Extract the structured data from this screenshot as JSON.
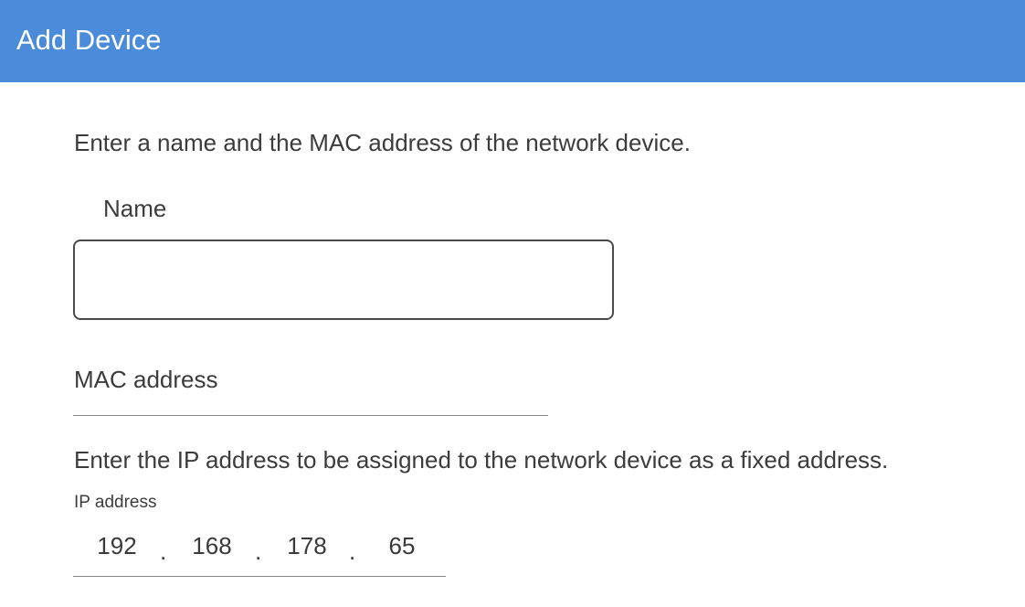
{
  "header": {
    "title": "Add Device"
  },
  "form": {
    "intro": "Enter a name and the MAC address of the network device.",
    "name_label": "Name",
    "name_value": "",
    "mac_label": "MAC address",
    "ip_intro": "Enter the IP address to be assigned to the network device as a fixed address.",
    "ip_label": "IP address",
    "ip_octets": [
      "192",
      "168",
      "178",
      "65"
    ],
    "ip_separator": "."
  },
  "colors": {
    "header_bg": "#4a8cda",
    "header_text": "#ffffff",
    "body_text": "#3c3c3c",
    "input_border": "#4a4a4a",
    "underline": "#8a8a8a"
  }
}
